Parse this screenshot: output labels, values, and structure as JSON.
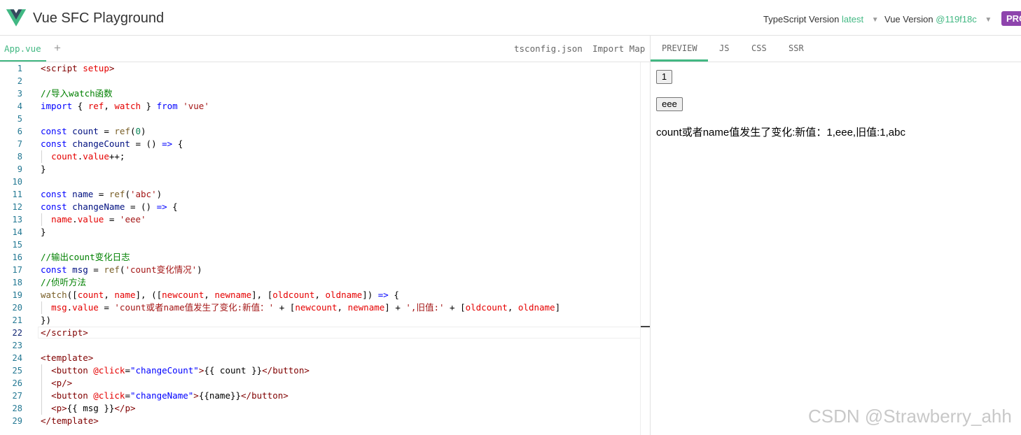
{
  "header": {
    "title": "Vue SFC Playground",
    "ts_label": "TypeScript Version",
    "ts_value": "latest",
    "vue_label": "Vue Version",
    "vue_value": "@119f18c",
    "prod_label": "PROD"
  },
  "editor": {
    "active_file": "App.vue",
    "add_label": "+",
    "tsconfig": "tsconfig.json",
    "import_map": "Import Map",
    "current_line": 22
  },
  "output_tabs": [
    "PREVIEW",
    "JS",
    "CSS",
    "SSR"
  ],
  "preview": {
    "count_button": "1",
    "name_button": "eee",
    "message": "count或者name值发生了变化:新值：1,eee,旧值:1,abc"
  },
  "code_lines": [
    [
      [
        "<",
        "t-tag"
      ],
      [
        "script",
        "t-tag"
      ],
      [
        " ",
        "t-plain"
      ],
      [
        "setup",
        "t-attr"
      ],
      [
        ">",
        "t-tag"
      ]
    ],
    [],
    [
      [
        "//导入watch函数",
        "t-cm"
      ]
    ],
    [
      [
        "import",
        "t-kw"
      ],
      [
        " { ",
        "t-plain"
      ],
      [
        "ref",
        "t-attr"
      ],
      [
        ", ",
        "t-plain"
      ],
      [
        "watch",
        "t-attr"
      ],
      [
        " } ",
        "t-plain"
      ],
      [
        "from",
        "t-kw"
      ],
      [
        " ",
        "t-plain"
      ],
      [
        "'vue'",
        "t-str"
      ]
    ],
    [],
    [
      [
        "const",
        "t-kw"
      ],
      [
        " ",
        "t-plain"
      ],
      [
        "count",
        "t-var"
      ],
      [
        " = ",
        "t-plain"
      ],
      [
        "ref",
        "t-fn"
      ],
      [
        "(",
        "t-plain"
      ],
      [
        "0",
        "t-num"
      ],
      [
        ")",
        "t-plain"
      ]
    ],
    [
      [
        "const",
        "t-kw"
      ],
      [
        " ",
        "t-plain"
      ],
      [
        "changeCount",
        "t-var"
      ],
      [
        " = () ",
        "t-plain"
      ],
      [
        "=>",
        "t-kw"
      ],
      [
        " {",
        "t-plain"
      ]
    ],
    [
      [
        "  ",
        "t-plain"
      ],
      [
        "count",
        "t-attr"
      ],
      [
        ".",
        "t-plain"
      ],
      [
        "value",
        "t-attr"
      ],
      [
        "++;",
        "t-plain"
      ]
    ],
    [
      [
        "}",
        "t-plain"
      ]
    ],
    [],
    [
      [
        "const",
        "t-kw"
      ],
      [
        " ",
        "t-plain"
      ],
      [
        "name",
        "t-var"
      ],
      [
        " = ",
        "t-plain"
      ],
      [
        "ref",
        "t-fn"
      ],
      [
        "(",
        "t-plain"
      ],
      [
        "'abc'",
        "t-str"
      ],
      [
        ")",
        "t-plain"
      ]
    ],
    [
      [
        "const",
        "t-kw"
      ],
      [
        " ",
        "t-plain"
      ],
      [
        "changeName",
        "t-var"
      ],
      [
        " = () ",
        "t-plain"
      ],
      [
        "=>",
        "t-kw"
      ],
      [
        " {",
        "t-plain"
      ]
    ],
    [
      [
        "  ",
        "t-plain"
      ],
      [
        "name",
        "t-attr"
      ],
      [
        ".",
        "t-plain"
      ],
      [
        "value",
        "t-attr"
      ],
      [
        " = ",
        "t-plain"
      ],
      [
        "'eee'",
        "t-str"
      ]
    ],
    [
      [
        "}",
        "t-plain"
      ]
    ],
    [],
    [
      [
        "//输出count变化日志",
        "t-cm"
      ]
    ],
    [
      [
        "const",
        "t-kw"
      ],
      [
        " ",
        "t-plain"
      ],
      [
        "msg",
        "t-var"
      ],
      [
        " = ",
        "t-plain"
      ],
      [
        "ref",
        "t-fn"
      ],
      [
        "(",
        "t-plain"
      ],
      [
        "'count变化情况'",
        "t-str"
      ],
      [
        ")",
        "t-plain"
      ]
    ],
    [
      [
        "//侦听方法",
        "t-cm"
      ]
    ],
    [
      [
        "watch",
        "t-fn"
      ],
      [
        "([",
        "t-plain"
      ],
      [
        "count",
        "t-attr"
      ],
      [
        ", ",
        "t-plain"
      ],
      [
        "name",
        "t-attr"
      ],
      [
        "], ([",
        "t-plain"
      ],
      [
        "newcount",
        "t-attr"
      ],
      [
        ", ",
        "t-plain"
      ],
      [
        "newname",
        "t-attr"
      ],
      [
        "], [",
        "t-plain"
      ],
      [
        "oldcount",
        "t-attr"
      ],
      [
        ", ",
        "t-plain"
      ],
      [
        "oldname",
        "t-attr"
      ],
      [
        "]) ",
        "t-plain"
      ],
      [
        "=>",
        "t-kw"
      ],
      [
        " {",
        "t-plain"
      ]
    ],
    [
      [
        "  ",
        "t-plain"
      ],
      [
        "msg",
        "t-attr"
      ],
      [
        ".",
        "t-plain"
      ],
      [
        "value",
        "t-attr"
      ],
      [
        " = ",
        "t-plain"
      ],
      [
        "'count或者name值发生了变化:新值：'",
        "t-str"
      ],
      [
        " + [",
        "t-plain"
      ],
      [
        "newcount",
        "t-attr"
      ],
      [
        ", ",
        "t-plain"
      ],
      [
        "newname",
        "t-attr"
      ],
      [
        "] + ",
        "t-plain"
      ],
      [
        "',旧值:'",
        "t-str"
      ],
      [
        " + [",
        "t-plain"
      ],
      [
        "oldcount",
        "t-attr"
      ],
      [
        ", ",
        "t-plain"
      ],
      [
        "oldname",
        "t-attr"
      ],
      [
        "]",
        "t-plain"
      ]
    ],
    [
      [
        "})",
        "t-plain"
      ]
    ],
    [
      [
        "</",
        "t-tag"
      ],
      [
        "script",
        "t-tag"
      ],
      [
        ">",
        "t-tag"
      ]
    ],
    [],
    [
      [
        "<",
        "t-tag"
      ],
      [
        "template",
        "t-tag"
      ],
      [
        ">",
        "t-tag"
      ]
    ],
    [
      [
        "  ",
        "t-plain"
      ],
      [
        "<",
        "t-tag"
      ],
      [
        "button",
        "t-tag"
      ],
      [
        " ",
        "t-plain"
      ],
      [
        "@click",
        "t-attr"
      ],
      [
        "=",
        "t-plain"
      ],
      [
        "\"changeCount\"",
        "t-kw"
      ],
      [
        ">",
        "t-tag"
      ],
      [
        "{{ count }}",
        "t-plain"
      ],
      [
        "</",
        "t-tag"
      ],
      [
        "button",
        "t-tag"
      ],
      [
        ">",
        "t-tag"
      ]
    ],
    [
      [
        "  ",
        "t-plain"
      ],
      [
        "<",
        "t-tag"
      ],
      [
        "p",
        "t-tag"
      ],
      [
        "/>",
        "t-tag"
      ]
    ],
    [
      [
        "  ",
        "t-plain"
      ],
      [
        "<",
        "t-tag"
      ],
      [
        "button",
        "t-tag"
      ],
      [
        " ",
        "t-plain"
      ],
      [
        "@click",
        "t-attr"
      ],
      [
        "=",
        "t-plain"
      ],
      [
        "\"changeName\"",
        "t-kw"
      ],
      [
        ">",
        "t-tag"
      ],
      [
        "{{name}}",
        "t-plain"
      ],
      [
        "</",
        "t-tag"
      ],
      [
        "button",
        "t-tag"
      ],
      [
        ">",
        "t-tag"
      ]
    ],
    [
      [
        "  ",
        "t-plain"
      ],
      [
        "<",
        "t-tag"
      ],
      [
        "p",
        "t-tag"
      ],
      [
        ">",
        "t-tag"
      ],
      [
        "{{ msg }}",
        "t-plain"
      ],
      [
        "</",
        "t-tag"
      ],
      [
        "p",
        "t-tag"
      ],
      [
        ">",
        "t-tag"
      ]
    ],
    [
      [
        "</",
        "t-tag"
      ],
      [
        "template",
        "t-tag"
      ],
      [
        ">",
        "t-tag"
      ]
    ]
  ],
  "indented_lines": [
    8,
    13,
    20,
    25,
    26,
    27,
    28
  ],
  "watermark": "CSDN @Strawberry_ahh"
}
